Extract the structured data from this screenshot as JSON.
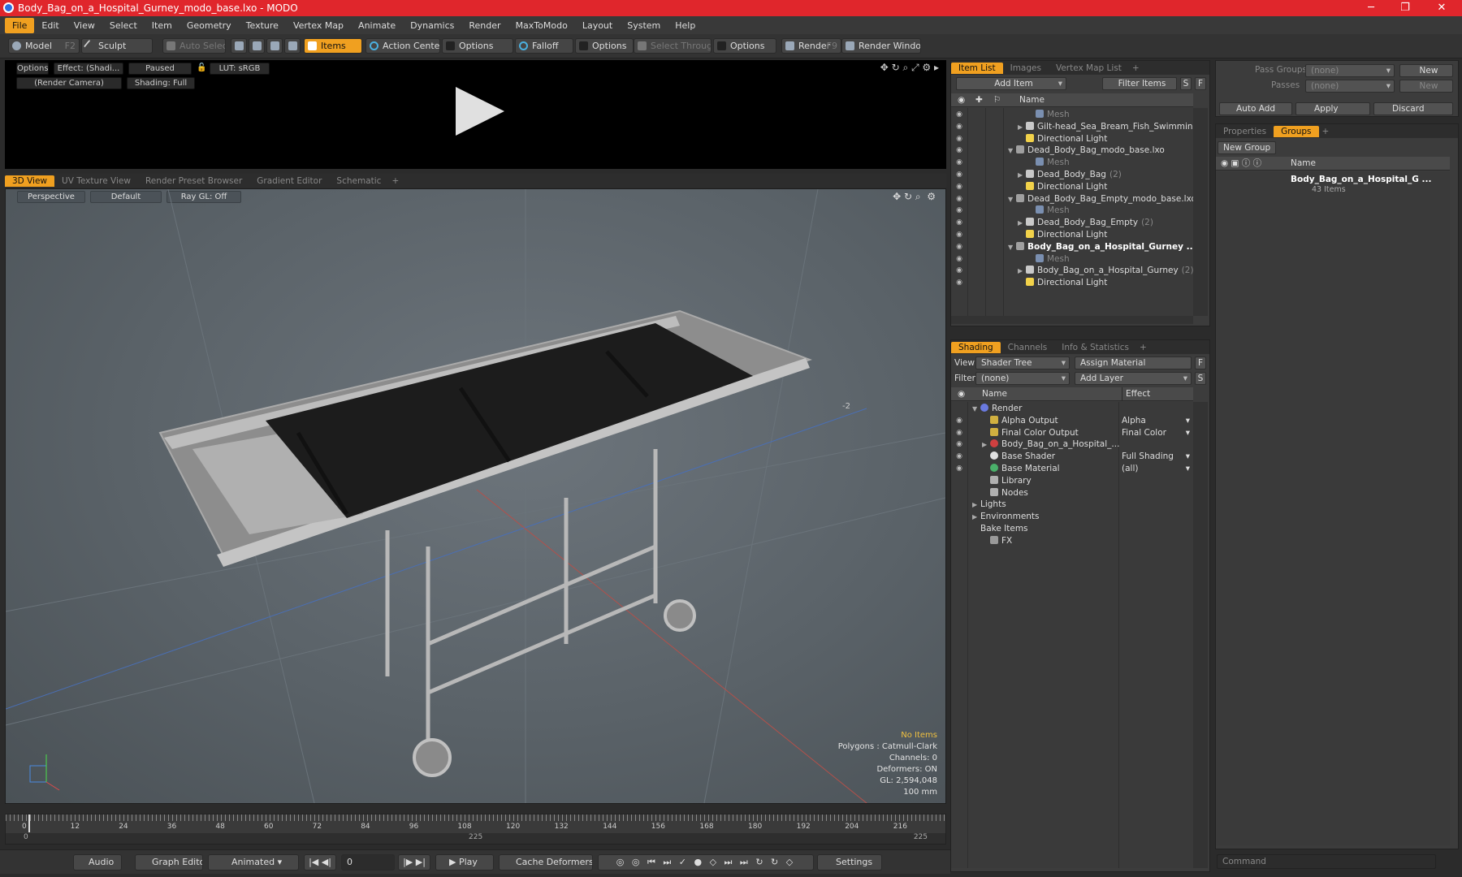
{
  "window": {
    "title": "Body_Bag_on_a_Hospital_Gurney_modo_base.lxo - MODO",
    "minimize": "─",
    "maximize": "❐",
    "close": "✕"
  },
  "menu": [
    "File",
    "Edit",
    "View",
    "Select",
    "Item",
    "Geometry",
    "Texture",
    "Vertex Map",
    "Animate",
    "Dynamics",
    "Render",
    "MaxToModo",
    "Layout",
    "System",
    "Help"
  ],
  "toolbar": {
    "model": "Model",
    "model_key": "F2",
    "sculpt": "Sculpt",
    "auto_select": "Auto Select",
    "items": "Items",
    "action_center": "Action Center",
    "options": "Options",
    "falloff": "Falloff",
    "select_through": "Select Through",
    "render": "Render",
    "render_key": "F9",
    "render_window": "Render Window"
  },
  "preview": {
    "options": "Options",
    "effect": "Effect: (Shadi...",
    "paused": "Paused",
    "lut": "LUT: sRGB",
    "camera": "(Render Camera)",
    "shading": "Shading: Full"
  },
  "view_tabs": [
    "3D View",
    "UV Texture View",
    "Render Preset Browser",
    "Gradient Editor",
    "Schematic",
    "+"
  ],
  "viewport": {
    "perspective": "Perspective",
    "default": "Default",
    "raygl": "Ray GL: Off",
    "axis_label": "-2"
  },
  "stats": {
    "no_items": "No Items",
    "polygons": "Polygons : Catmull-Clark",
    "channels": "Channels: 0",
    "deformers": "Deformers: ON",
    "gl": "GL: 2,594,048",
    "unit": "100 mm"
  },
  "timeline": {
    "ticks": [
      "0",
      "12",
      "24",
      "36",
      "48",
      "60",
      "72",
      "84",
      "96",
      "108",
      "120",
      "132",
      "144",
      "156",
      "168",
      "180",
      "192",
      "204",
      "216"
    ],
    "start": "0",
    "mid": "225",
    "end": "225"
  },
  "bottom": {
    "audio": "Audio",
    "graph_editor": "Graph Editor",
    "animated": "Animated",
    "frame": "0",
    "play": "Play",
    "cache": "Cache Deformers",
    "settings": "Settings"
  },
  "item_list": {
    "tabs": [
      "Item List",
      "Images",
      "Vertex Map List",
      "+"
    ],
    "add_item": "Add Item",
    "filter": "Filter Items",
    "s": "S",
    "f": "F",
    "col_name": "Name",
    "rows": [
      {
        "indent": 3,
        "text": "Mesh",
        "type": "mesh",
        "muted": true
      },
      {
        "indent": 2,
        "text": "Gilt-head_Sea_Bream_Fish_Swimming",
        "type": "group",
        "arrow": "▶"
      },
      {
        "indent": 2,
        "text": "Directional Light",
        "type": "light"
      },
      {
        "indent": 1,
        "text": "Dead_Body_Bag_modo_base.lxo",
        "type": "scene",
        "arrow": "▼"
      },
      {
        "indent": 3,
        "text": "Mesh",
        "type": "mesh",
        "muted": true
      },
      {
        "indent": 2,
        "text": "Dead_Body_Bag",
        "count": "(2)",
        "type": "group",
        "arrow": "▶"
      },
      {
        "indent": 2,
        "text": "Directional Light",
        "type": "light"
      },
      {
        "indent": 1,
        "text": "Dead_Body_Bag_Empty_modo_base.lxo",
        "type": "scene",
        "arrow": "▼"
      },
      {
        "indent": 3,
        "text": "Mesh",
        "type": "mesh",
        "muted": true
      },
      {
        "indent": 2,
        "text": "Dead_Body_Bag_Empty",
        "count": "(2)",
        "type": "group",
        "arrow": "▶"
      },
      {
        "indent": 2,
        "text": "Directional Light",
        "type": "light"
      },
      {
        "indent": 1,
        "text": "Body_Bag_on_a_Hospital_Gurney ...",
        "type": "scene",
        "arrow": "▼",
        "bold": true
      },
      {
        "indent": 3,
        "text": "Mesh",
        "type": "mesh",
        "muted": true
      },
      {
        "indent": 2,
        "text": "Body_Bag_on_a_Hospital_Gurney",
        "count": "(2)",
        "type": "group",
        "arrow": "▶"
      },
      {
        "indent": 2,
        "text": "Directional Light",
        "type": "light"
      }
    ]
  },
  "shading": {
    "tabs": [
      "Shading",
      "Channels",
      "Info & Statistics",
      "+"
    ],
    "view_label": "View",
    "view_value": "Shader Tree",
    "assign": "Assign Material",
    "filter_label": "Filter",
    "filter_value": "(none)",
    "add_layer": "Add Layer",
    "f": "F",
    "s": "S",
    "col_name": "Name",
    "col_effect": "Effect",
    "rows": [
      {
        "indent": 0,
        "text": "Render",
        "effect": "",
        "type": "render",
        "arrow": "▼",
        "eye": false
      },
      {
        "indent": 1,
        "text": "Alpha Output",
        "effect": "Alpha",
        "type": "output",
        "eye": true
      },
      {
        "indent": 1,
        "text": "Final Color Output",
        "effect": "Final Color",
        "type": "output",
        "eye": true
      },
      {
        "indent": 1,
        "text": "Body_Bag_on_a_Hospital_...",
        "effect": "",
        "type": "material",
        "arrow": "▶",
        "eye": true
      },
      {
        "indent": 1,
        "text": "Base Shader",
        "effect": "Full Shading",
        "type": "shader",
        "eye": true
      },
      {
        "indent": 1,
        "text": "Base Material",
        "effect": "(all)",
        "type": "basemat",
        "eye": true
      },
      {
        "indent": 1,
        "text": "Library",
        "effect": "",
        "type": "folder",
        "eye": false
      },
      {
        "indent": 1,
        "text": "Nodes",
        "effect": "",
        "type": "folder",
        "eye": false
      },
      {
        "indent": 0,
        "text": "Lights",
        "effect": "",
        "type": "none",
        "arrow": "▶",
        "eye": false
      },
      {
        "indent": 0,
        "text": "Environments",
        "effect": "",
        "type": "none",
        "arrow": "▶",
        "eye": false
      },
      {
        "indent": 0,
        "text": "Bake Items",
        "effect": "",
        "type": "none",
        "eye": false
      },
      {
        "indent": 1,
        "text": "FX",
        "effect": "",
        "type": "fx",
        "eye": false
      }
    ]
  },
  "passes": {
    "pass_groups": "Pass Groups",
    "pass_value": "(none)",
    "new": "New",
    "passes": "Passes",
    "passes_value": "(none)",
    "new2": "New",
    "auto_add": "Auto Add",
    "apply": "Apply",
    "discard": "Discard"
  },
  "groups": {
    "tabs": [
      "Properties",
      "Groups",
      "+"
    ],
    "new_group": "New Group",
    "col_name": "Name",
    "item_name": "Body_Bag_on_a_Hospital_G ...",
    "item_count": "43 Items"
  },
  "command": {
    "placeholder": "Command"
  },
  "colors": {
    "accent": "#f0a020",
    "title_red": "#e0262c"
  }
}
